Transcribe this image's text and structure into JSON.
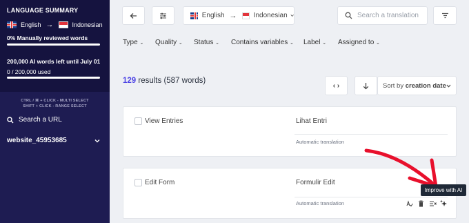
{
  "sidebar": {
    "title": "LANGUAGE SUMMARY",
    "source_lang": "English",
    "target_lang": "Indonesian",
    "reviewed": "0% Manually reviewed words",
    "ai_words": "200,000 AI words left until July 01",
    "used": "0 / 200,000 used",
    "hint1": "CTRL / ⌘ + CLICK - MULTI SELECT",
    "hint2": "SHIFT + CLICK - RANGE SELECT",
    "search_url": "Search a URL",
    "website": "website_45953685"
  },
  "toolbar": {
    "source_lang": "English",
    "target_lang": "Indonesian",
    "search_placeholder": "Search a translation"
  },
  "filters": [
    "Type",
    "Quality",
    "Status",
    "Contains variables",
    "Label",
    "Assigned to"
  ],
  "results": {
    "count": "129",
    "text": " results (587 words)",
    "sort_prefix": "Sort by ",
    "sort_value": "creation date"
  },
  "entries": [
    {
      "source": "View Entries",
      "target": "Lihat Entri",
      "status": "Automatic translation"
    },
    {
      "source": "Edit Form",
      "target": "Formulir Edit",
      "status": "Automatic translation"
    }
  ],
  "tooltip": "Improve with AI",
  "colors": {
    "sidebar": "#1e1c52",
    "accent": "#4f46e5",
    "annotation": "#e8102c"
  }
}
